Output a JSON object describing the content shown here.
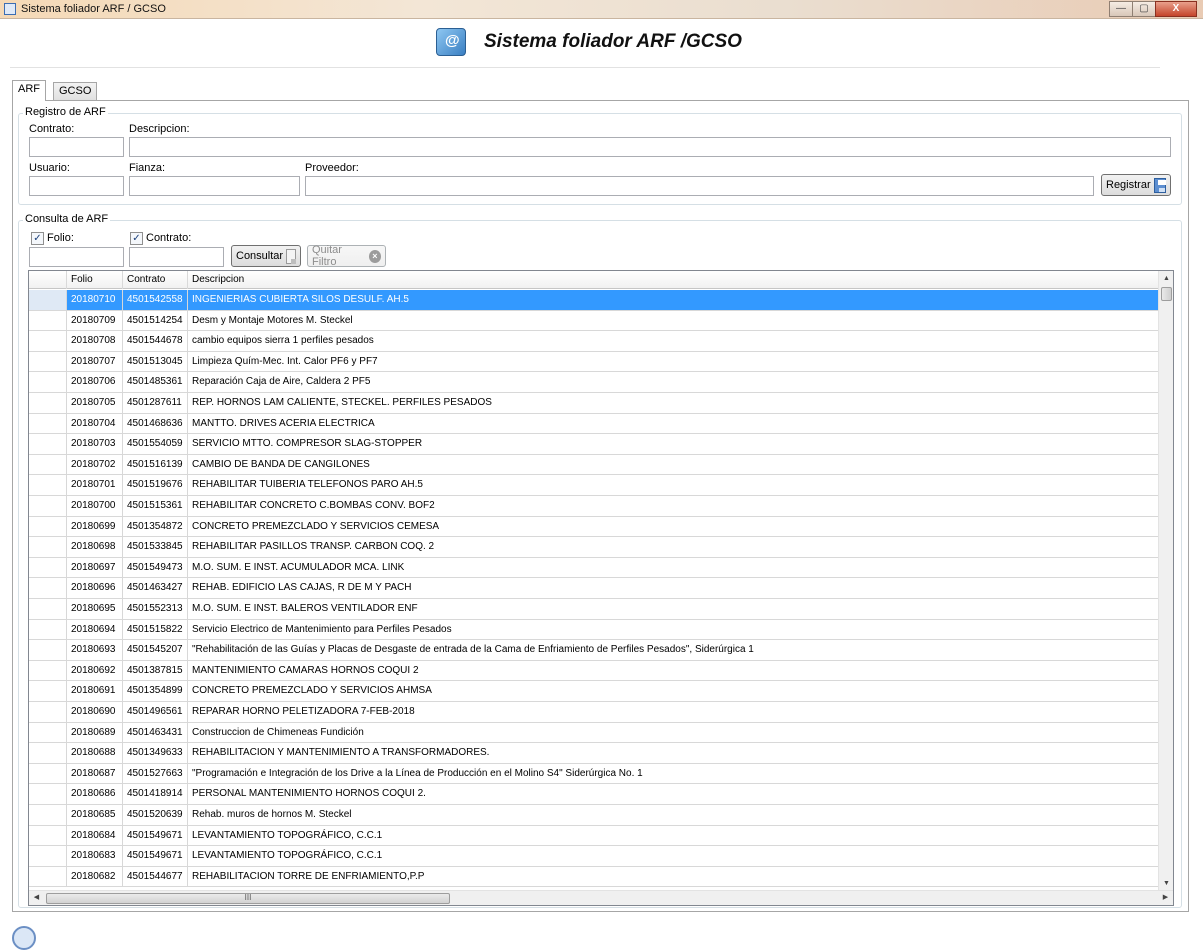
{
  "window": {
    "title": "Sistema foliador ARF / GCSO",
    "buttons": {
      "minimize": "—",
      "maximize": "▢",
      "close": "X"
    }
  },
  "header": {
    "title": "Sistema foliador ARF /GCSO",
    "logo_icon": "app-logo-icon"
  },
  "tabs": [
    {
      "label": "ARF",
      "active": true
    },
    {
      "label": "GCSO",
      "active": false
    }
  ],
  "registro": {
    "legend": "Registro de ARF",
    "contrato_label": "Contrato:",
    "descripcion_label": "Descripcion:",
    "usuario_label": "Usuario:",
    "fianza_label": "Fianza:",
    "proveedor_label": "Proveedor:",
    "registrar_label": "Registrar",
    "contrato_value": "",
    "descripcion_value": "",
    "usuario_value": "",
    "fianza_value": "",
    "proveedor_value": ""
  },
  "consulta": {
    "legend": "Consulta de ARF",
    "folio_label": "Folio:",
    "folio_checked": true,
    "contrato_label": "Contrato:",
    "contrato_checked": true,
    "consultar_label": "Consultar",
    "quitar_label": "Quitar Filtro",
    "folio_value": "",
    "contrato_value": ""
  },
  "grid": {
    "columns": [
      "Folio",
      "Contrato",
      "Descripcion"
    ],
    "selected_index": 0,
    "rows": [
      [
        "20180710",
        "4501542558",
        "INGENIERIAS CUBIERTA SILOS DESULF. AH.5"
      ],
      [
        "20180709",
        "4501514254",
        "Desm y Montaje Motores M. Steckel"
      ],
      [
        "20180708",
        "4501544678",
        "cambio equipos sierra 1 perfiles pesados"
      ],
      [
        "20180707",
        "4501513045",
        "Limpieza Quím-Mec. Int. Calor PF6 y PF7"
      ],
      [
        "20180706",
        "4501485361",
        "Reparación Caja de Aire, Caldera 2 PF5"
      ],
      [
        "20180705",
        "4501287611",
        "REP. HORNOS LAM CALIENTE, STECKEL. PERFILES PESADOS"
      ],
      [
        "20180704",
        "4501468636",
        "MANTTO. DRIVES ACERIA ELECTRICA"
      ],
      [
        "20180703",
        "4501554059",
        "SERVICIO MTTO. COMPRESOR SLAG-STOPPER"
      ],
      [
        "20180702",
        "4501516139",
        "CAMBIO DE BANDA DE CANGILONES"
      ],
      [
        "20180701",
        "4501519676",
        "REHABILITAR TUIBERIA TELEFONOS PARO AH.5"
      ],
      [
        "20180700",
        "4501515361",
        "REHABILITAR CONCRETO C.BOMBAS CONV. BOF2"
      ],
      [
        "20180699",
        "4501354872",
        "CONCRETO PREMEZCLADO Y SERVICIOS CEMESA"
      ],
      [
        "20180698",
        "4501533845",
        "REHABILITAR PASILLOS TRANSP. CARBON COQ. 2"
      ],
      [
        "20180697",
        "4501549473",
        "M.O. SUM. E INST.  ACUMULADOR MCA. LINK"
      ],
      [
        "20180696",
        "4501463427",
        "REHAB. EDIFICIO LAS CAJAS, R DE M Y PACH"
      ],
      [
        "20180695",
        "4501552313",
        "M.O. SUM. E INST. BALEROS VENTILADOR ENF"
      ],
      [
        "20180694",
        "4501515822",
        "Servicio Electrico de Mantenimiento para Perfiles Pesados"
      ],
      [
        "20180693",
        "4501545207",
        "\"Rehabilitación de las Guías y Placas de Desgaste de entrada de la Cama de Enfriamiento de Perfiles Pesados\", Siderúrgica 1"
      ],
      [
        "20180692",
        "4501387815",
        "MANTENIMIENTO CAMARAS HORNOS COQUI 2"
      ],
      [
        "20180691",
        "4501354899",
        "CONCRETO PREMEZCLADO Y SERVICIOS AHMSA"
      ],
      [
        "20180690",
        "4501496561",
        "REPARAR HORNO PELETIZADORA 7-FEB-2018"
      ],
      [
        "20180689",
        "4501463431",
        "Construccion de Chimeneas Fundición"
      ],
      [
        "20180688",
        "4501349633",
        "REHABILITACION Y MANTENIMIENTO A TRANSFORMADORES."
      ],
      [
        "20180687",
        "4501527663",
        "\"Programación e Integración de los Drive a la Línea de Producción en el Molino S4\" Siderúrgica No. 1"
      ],
      [
        "20180686",
        "4501418914",
        "PERSONAL MANTENIMIENTO HORNOS COQUI 2."
      ],
      [
        "20180685",
        "4501520639",
        "Rehab. muros de hornos M. Steckel"
      ],
      [
        "20180684",
        "4501549671",
        "LEVANTAMIENTO TOPOGRÁFICO, C.C.1"
      ],
      [
        "20180683",
        "4501549671",
        "LEVANTAMIENTO TOPOGRÁFICO, C.C.1"
      ],
      [
        "20180682",
        "4501544677",
        "REHABILITACION TORRE DE ENFRIAMIENTO,P.P"
      ]
    ],
    "hscroll_thumb_label": "III"
  }
}
